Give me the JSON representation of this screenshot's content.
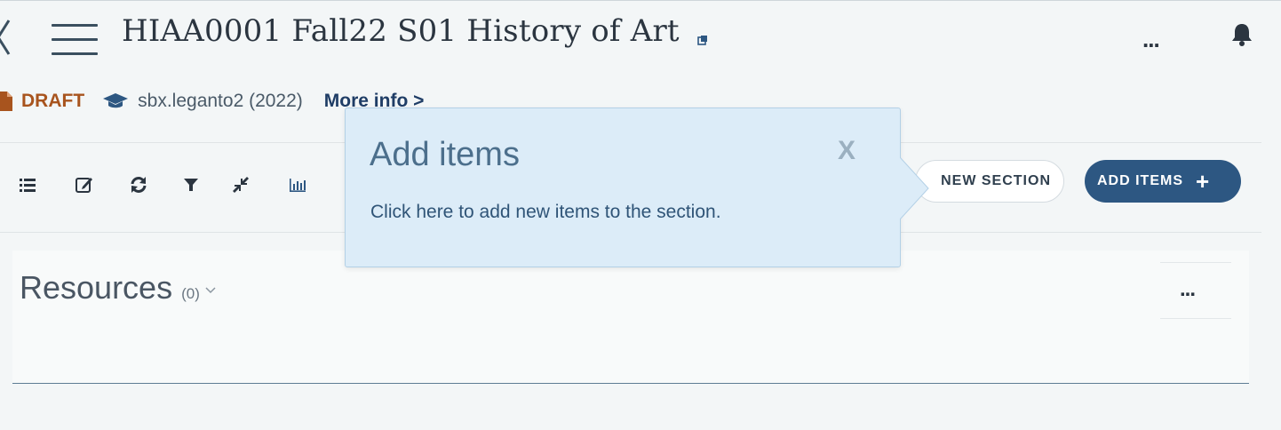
{
  "header": {
    "course_title": "HIAA0001 Fall22 S01 History of Art",
    "more_label": "..."
  },
  "meta": {
    "status": "DRAFT",
    "institution": "sbx.leganto2 (2022)",
    "more_info": "More info >"
  },
  "toolbar": {
    "new_section_label": "NEW SECTION",
    "add_items_label": "ADD ITEMS",
    "add_items_icon": "+"
  },
  "section": {
    "title": "Resources",
    "count": "(0)",
    "menu_label": "..."
  },
  "popover": {
    "title": "Add items",
    "close_label": "X",
    "body": "Click here to add new items to the section."
  },
  "colors": {
    "accent": "#2d5782",
    "draft": "#a8541e",
    "popover_bg": "#dcecf8"
  }
}
